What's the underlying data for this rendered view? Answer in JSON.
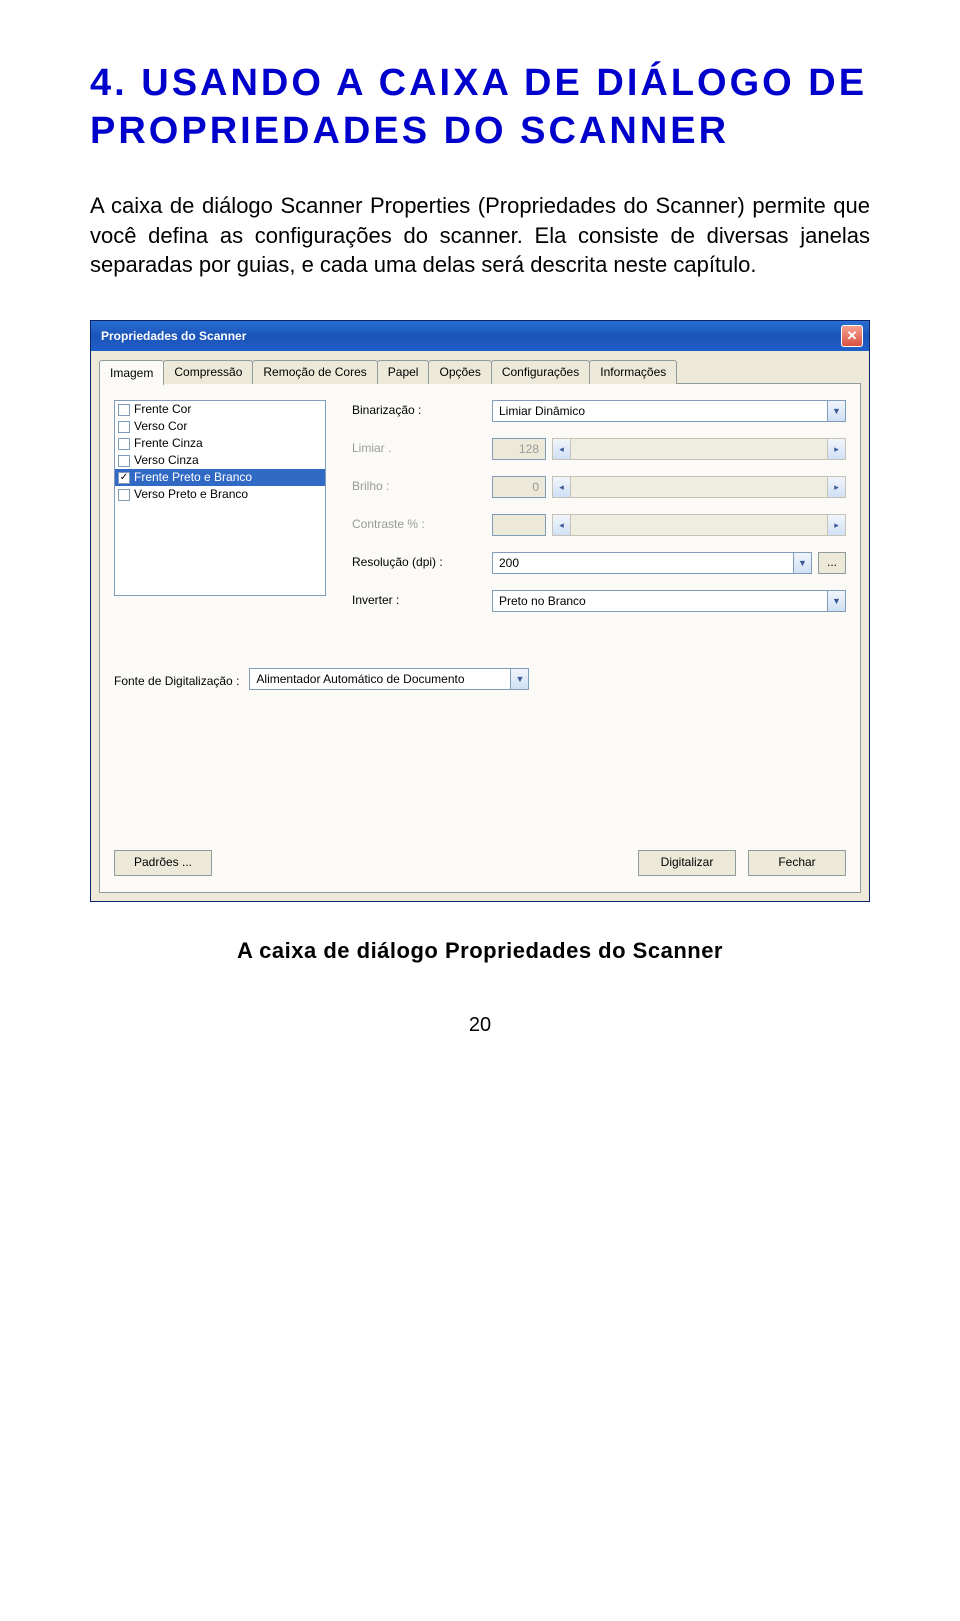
{
  "heading": "4. USANDO A CAIXA DE DIÁLOGO DE PROPRIEDADES DO SCANNER",
  "paragraph": "A caixa de diálogo Scanner Properties (Propriedades do Scanner) permite que você defina as configurações do scanner. Ela consiste de diversas janelas separadas por guias, e cada uma delas será descrita neste capítulo.",
  "dialog": {
    "title": "Propriedades do Scanner",
    "tabs": [
      "Imagem",
      "Compressão",
      "Remoção de Cores",
      "Papel",
      "Opções",
      "Configurações",
      "Informações"
    ],
    "image_list": [
      {
        "label": "Frente Cor",
        "checked": false,
        "selected": false
      },
      {
        "label": "Verso Cor",
        "checked": false,
        "selected": false
      },
      {
        "label": "Frente Cinza",
        "checked": false,
        "selected": false
      },
      {
        "label": "Verso Cinza",
        "checked": false,
        "selected": false
      },
      {
        "label": "Frente Preto e Branco",
        "checked": true,
        "selected": true
      },
      {
        "label": "Verso Preto e Branco",
        "checked": false,
        "selected": false
      }
    ],
    "fields": {
      "binarizacao": {
        "label": "Binarização :",
        "value": "Limiar Dinâmico"
      },
      "limiar": {
        "label": "Limiar .",
        "value": "128"
      },
      "brilho": {
        "label": "Brilho :",
        "value": "0"
      },
      "contraste": {
        "label": "Contraste % :",
        "value": ""
      },
      "resolucao": {
        "label": "Resolução (dpi) :",
        "value": "200"
      },
      "inverter": {
        "label": "Inverter :",
        "value": "Preto no Branco"
      },
      "source": {
        "label": "Fonte de Digitalização :",
        "value": "Alimentador  Automático de Documento"
      }
    },
    "buttons": {
      "defaults": "Padrões ...",
      "scan": "Digitalizar",
      "close": "Fechar"
    },
    "ellipsis": "..."
  },
  "caption": "A caixa de diálogo Propriedades do Scanner",
  "page_number": "20"
}
